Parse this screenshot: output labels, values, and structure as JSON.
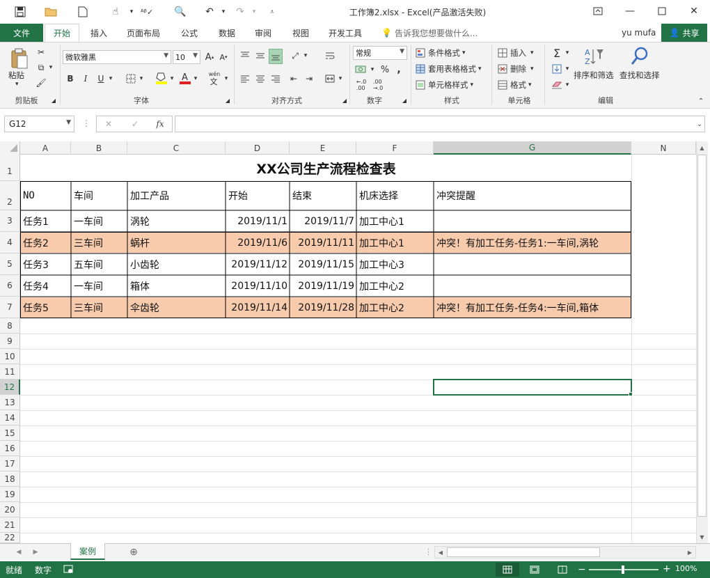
{
  "window": {
    "title": "工作簿2.xlsx - Excel(产品激活失败)"
  },
  "tabs": {
    "file": "文件",
    "items": [
      "开始",
      "插入",
      "页面布局",
      "公式",
      "数据",
      "审阅",
      "视图",
      "开发工具"
    ],
    "tell_me": "告诉我您想要做什么...",
    "user": "yu mufa",
    "share": "共享"
  },
  "ribbon": {
    "clipboard": {
      "paste": "粘贴",
      "label": "剪贴板"
    },
    "font": {
      "name": "微软雅黑",
      "size": "10",
      "label": "字体",
      "bold": "B",
      "italic": "I",
      "underline": "U",
      "wen": "wén"
    },
    "alignment": {
      "label": "对齐方式"
    },
    "number": {
      "format": "常规",
      "label": "数字",
      "percent": "%"
    },
    "styles": {
      "conditional": "条件格式",
      "table": "套用表格格式",
      "cell": "单元格样式",
      "label": "样式"
    },
    "cells": {
      "insert": "插入",
      "delete": "删除",
      "format": "格式",
      "label": "单元格"
    },
    "editing": {
      "sort": "排序和筛选",
      "find": "查找和选择",
      "label": "编辑"
    }
  },
  "formula_bar": {
    "name_box": "G12",
    "fx": "fx",
    "value": ""
  },
  "columns": [
    "A",
    "B",
    "C",
    "D",
    "E",
    "F",
    "G",
    "N"
  ],
  "rows": [
    "1",
    "2",
    "3",
    "4",
    "5",
    "6",
    "7",
    "8",
    "9",
    "10",
    "11",
    "12",
    "13",
    "14",
    "15",
    "16",
    "17",
    "18",
    "19",
    "20",
    "21",
    "22"
  ],
  "sheet": {
    "title": "XX公司生产流程检查表",
    "headers": [
      "NO",
      "车间",
      "加工产品",
      "开始",
      "结束",
      "机床选择",
      "冲突提醒"
    ],
    "data": [
      [
        "任务1",
        "一车间",
        "涡轮",
        "2019/11/1",
        "2019/11/7",
        "加工中心1",
        ""
      ],
      [
        "任务2",
        "三车间",
        "蜗杆",
        "2019/11/6",
        "2019/11/11",
        "加工中心1",
        "冲突！有加工任务-任务1:一车间,涡轮"
      ],
      [
        "任务3",
        "五车间",
        "小齿轮",
        "2019/11/12",
        "2019/11/15",
        "加工中心3",
        ""
      ],
      [
        "任务4",
        "一车间",
        "箱体",
        "2019/11/10",
        "2019/11/19",
        "加工中心2",
        ""
      ],
      [
        "任务5",
        "三车间",
        "伞齿轮",
        "2019/11/14",
        "2019/11/28",
        "加工中心2",
        "冲突！有加工任务-任务4:一车间,箱体"
      ]
    ],
    "highlight_color": "#f8cbad"
  },
  "sheet_tabs": {
    "active": "案例"
  },
  "status": {
    "ready": "就绪",
    "mode": "数字",
    "zoom": "100%"
  },
  "colors": {
    "accent": "#217346"
  }
}
